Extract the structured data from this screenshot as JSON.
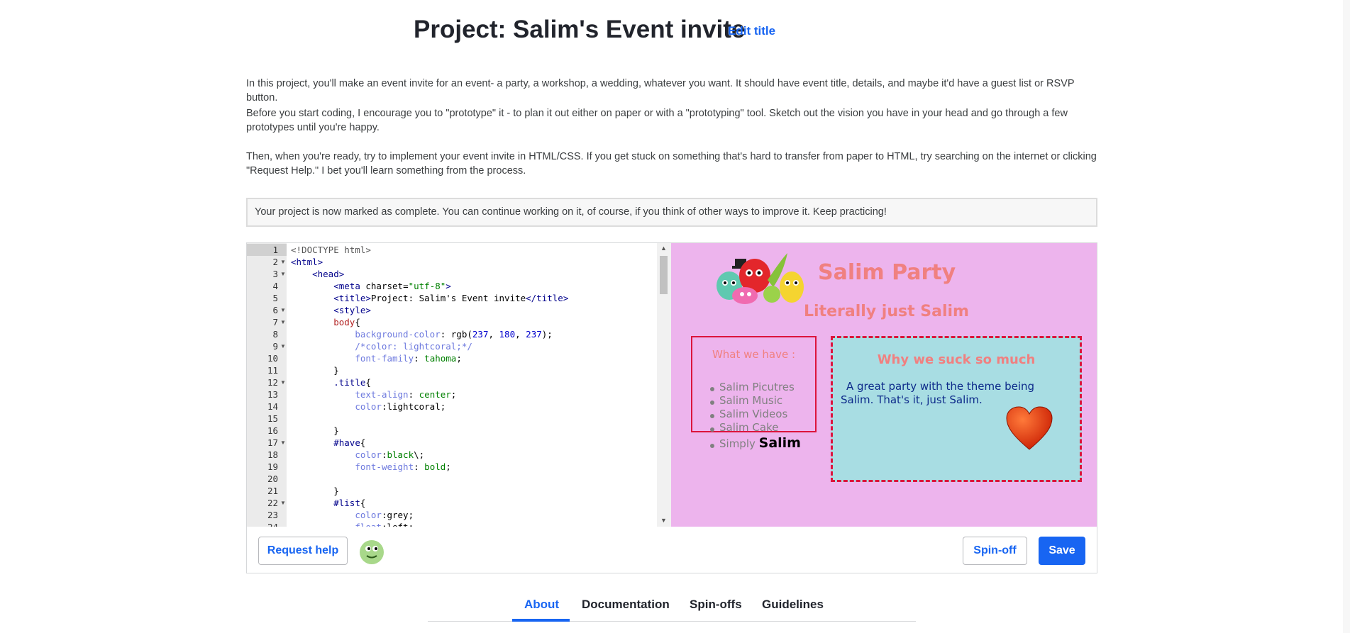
{
  "header": {
    "title": "Project: Salim's Event invite",
    "edit_title": "Edit title"
  },
  "description": {
    "p1": "In this project, you'll make an event invite for an event- a party, a workshop, a wedding, whatever you want. It should have event title, details, and maybe it'd have a guest list or RSVP button.",
    "p2": "Before you start coding, I encourage you to \"prototype\" it - to plan it out either on paper or with a \"prototyping\" tool. Sketch out the vision you have in your head and go through a few prototypes until you're happy.",
    "p3": "Then, when you're ready, try to implement your event invite in HTML/CSS. If you get stuck on something that's hard to transfer from paper to HTML, try searching on the internet or clicking \"Request Help.\" I bet you'll learn something from the process."
  },
  "complete_notice": "Your project is now marked as complete. You can continue working on it, of course, if you think of other ways to improve it. Keep practicing!",
  "editor": {
    "line_numbers": [
      "1",
      "2",
      "3",
      "4",
      "5",
      "6",
      "7",
      "8",
      "9",
      "10",
      "11",
      "12",
      "13",
      "14",
      "15",
      "16",
      "17",
      "18",
      "19",
      "20",
      "21",
      "22",
      "23",
      "24"
    ],
    "lines": [
      "<!DOCTYPE html>",
      "<html>",
      "    <head>",
      "        <meta charset=\"utf-8\">",
      "        <title>Project: Salim's Event invite</title>",
      "        <style>",
      "        body{",
      "            background-color: rgb(237, 180, 237);",
      "            /*color: lightcoral;*/",
      "            font-family: tahoma;",
      "        }",
      "        .title{",
      "            text-align: center;",
      "            color:lightcoral;",
      "",
      "        }",
      "        #have{",
      "            color:black\\;",
      "            font-weight: bold;",
      "",
      "        }",
      "        #list{",
      "            color:grey;",
      "            float:left;"
    ]
  },
  "preview": {
    "title": "Salim Party",
    "subtitle": "Literally just Salim",
    "have_heading": "What we have :",
    "have_items": [
      "Salim Picutres",
      "Salim Music",
      "Salim Videos",
      "Salim Cake"
    ],
    "have_last_prefix": "Simply",
    "have_last_bold": "Salim",
    "why_heading": "Why we suck so much",
    "why_text": "A great party with the theme being Salim. That's it, just Salim."
  },
  "actions": {
    "request_help": "Request help",
    "spinoff": "Spin-off",
    "save": "Save"
  },
  "tabs": [
    "About",
    "Documentation",
    "Spin-offs",
    "Guidelines"
  ],
  "colors": {
    "accent": "#1865f2",
    "preview_bg": "#edb4ed",
    "box_bg": "#a8dde3",
    "crimson": "#dc143c"
  }
}
